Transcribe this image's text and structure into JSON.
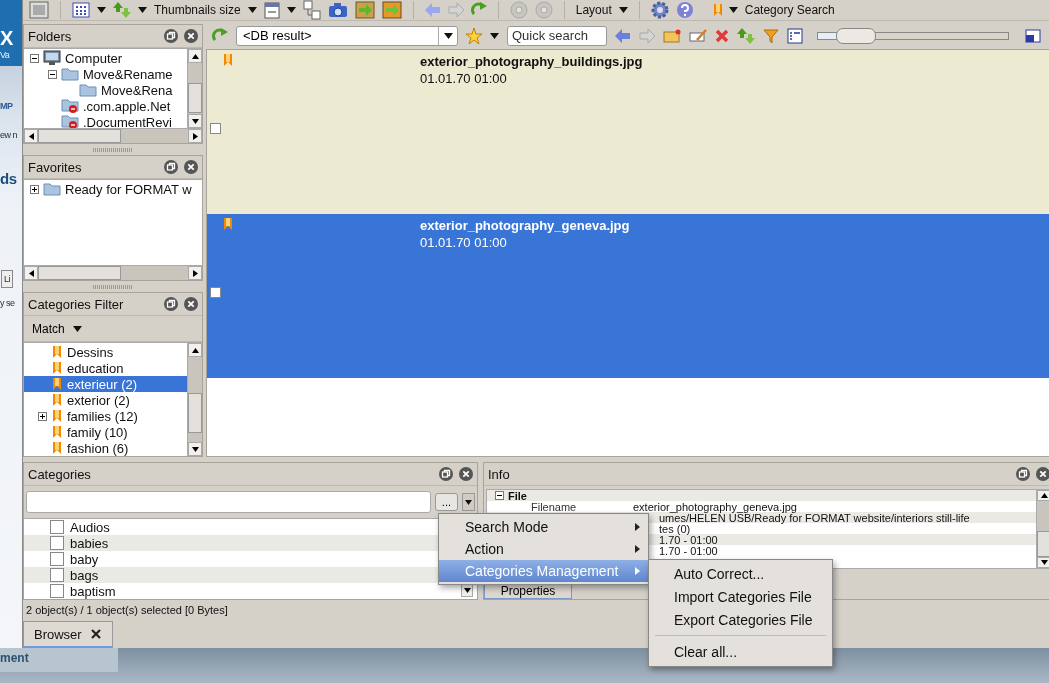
{
  "background_page": {
    "fragments": [
      "X",
      "Va",
      "MP",
      "ew n",
      "ds",
      "Li",
      "y se"
    ],
    "footer": "ment"
  },
  "toolbar": {
    "thumbnails_size": "Thumbnails size",
    "layout": "Layout",
    "category_search": "Category Search"
  },
  "folders": {
    "title": "Folders",
    "tree": [
      {
        "label": "Computer",
        "kind": "computer",
        "expanded": true,
        "children": [
          {
            "label": "Move&Rename",
            "kind": "folder",
            "expanded": true,
            "children": [
              {
                "label": "Move&Rena",
                "kind": "folder"
              }
            ]
          },
          {
            "label": ".com.apple.Net",
            "kind": "restricted"
          },
          {
            "label": ".DocumentRevi",
            "kind": "restricted"
          }
        ]
      }
    ]
  },
  "favorites": {
    "title": "Favorites",
    "tree": [
      {
        "label": "Ready for FORMAT w",
        "kind": "folder",
        "expanded": false
      }
    ]
  },
  "categories_filter": {
    "title": "Categories Filter",
    "match": "Match",
    "items": [
      {
        "label": "Dessins",
        "selected": false
      },
      {
        "label": "education",
        "selected": false
      },
      {
        "label": "exterieur (2)",
        "selected": true
      },
      {
        "label": "exterior (2)",
        "selected": false
      },
      {
        "label": "families (12)",
        "selected": false,
        "expanded": false
      },
      {
        "label": "family (10)",
        "selected": false
      },
      {
        "label": "fashion (6)",
        "selected": false
      }
    ]
  },
  "browser_toolbar": {
    "location": "<DB result>",
    "search": {
      "placeholder": "Quick search"
    },
    "zoom": {
      "level": 0.12
    }
  },
  "thumbnails": [
    {
      "name": "exterior_photography_buildings.jpg",
      "date": "01.01.70 01:00",
      "selected": false,
      "checked": false
    },
    {
      "name": "exterior_photography_geneva.jpg",
      "date": "01.01.70 01:00",
      "selected": true,
      "checked": false
    }
  ],
  "categories": {
    "title": "Categories",
    "more_button": "...",
    "items": [
      {
        "label": "Audios",
        "checked": false
      },
      {
        "label": "babies",
        "checked": false
      },
      {
        "label": "baby",
        "checked": false
      },
      {
        "label": "bags",
        "checked": false
      },
      {
        "label": "baptism",
        "checked": false
      }
    ]
  },
  "info": {
    "title": "Info",
    "group": "File",
    "rows": [
      {
        "label": "Filename",
        "value": "exterior_photography_geneva.jpg",
        "kind": "full"
      },
      {
        "value": "umes/HELEN USB/Ready for FORMAT website/interiors still-life",
        "kind": "partial"
      },
      {
        "value": "tes (0)",
        "kind": "partial"
      },
      {
        "value": "1.70 - 01:00",
        "kind": "partial"
      },
      {
        "value": "1.70 - 01:00",
        "kind": "partial"
      }
    ],
    "properties_button": "Properties"
  },
  "status_bar": "2 object(s) / 1 object(s) selected [0 Bytes]",
  "tabs": [
    {
      "label": "Browser",
      "selected": true
    }
  ],
  "context_menu": {
    "items": [
      {
        "label": "Search Mode",
        "submenu": true,
        "selected": false
      },
      {
        "label": "Action",
        "submenu": true,
        "selected": false
      },
      {
        "label": "Categories Management",
        "submenu": true,
        "selected": true
      }
    ],
    "submenu": [
      {
        "label": "Auto Correct...",
        "separator_before": false
      },
      {
        "label": "Import Categories File",
        "separator_before": false
      },
      {
        "label": "Export Categories File",
        "separator_before": false
      },
      {
        "label": "Clear all...",
        "separator_before": true
      }
    ]
  }
}
